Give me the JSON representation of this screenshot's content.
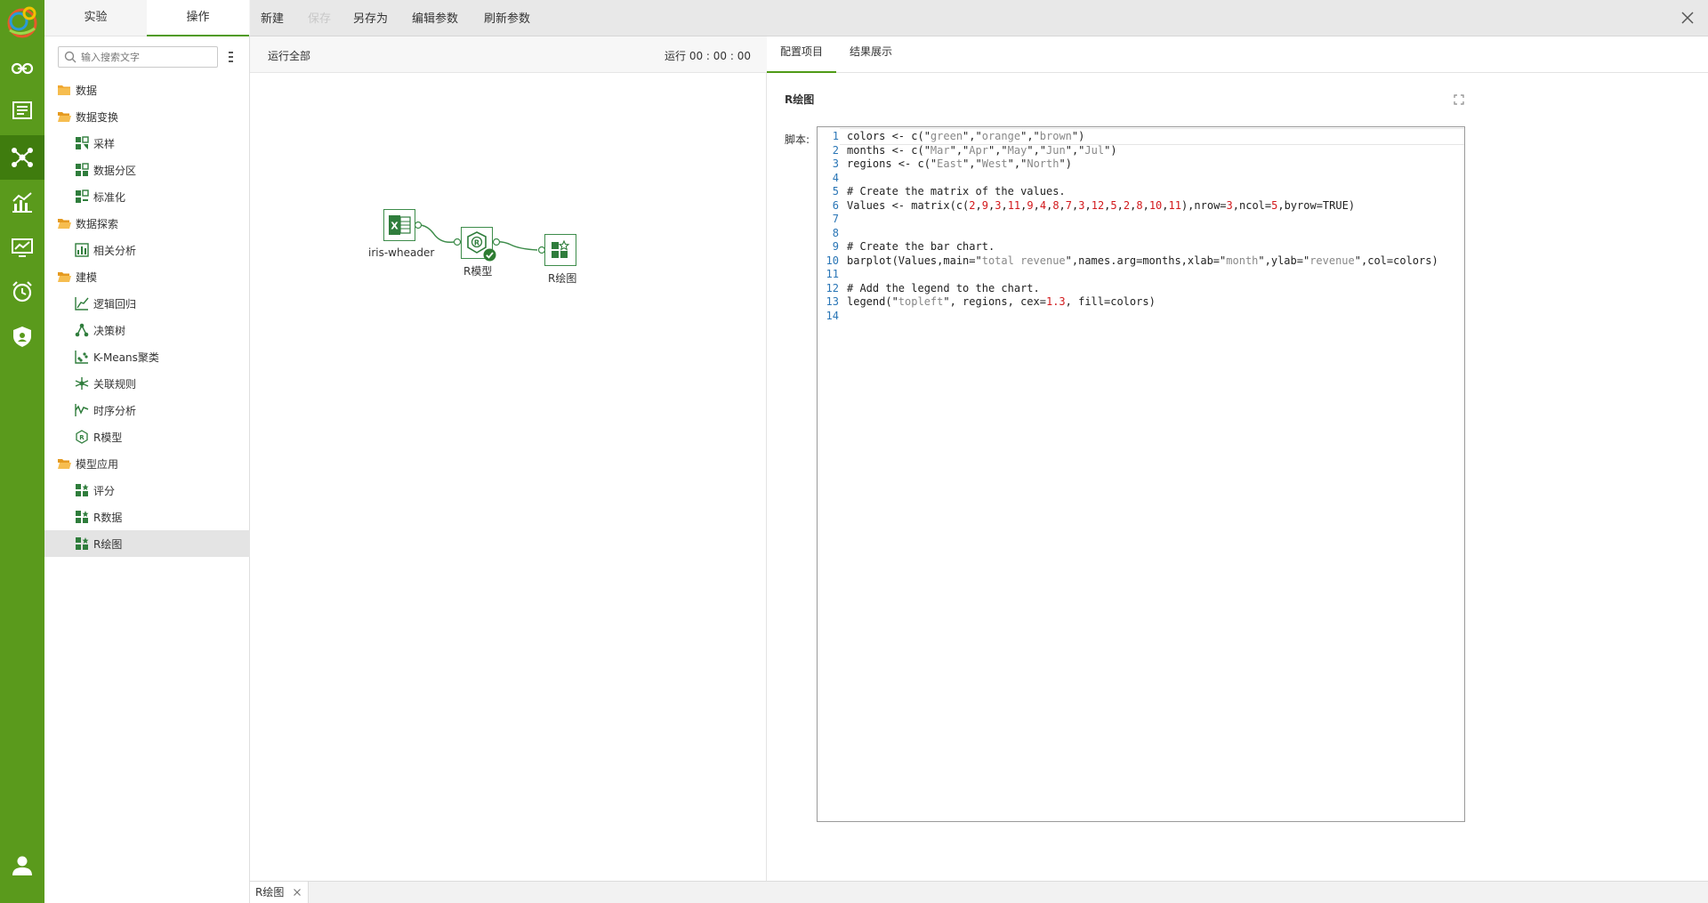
{
  "tree": {
    "tabs": [
      "实验",
      "操作"
    ],
    "search_placeholder": "输入搜索文字",
    "items": [
      {
        "label": "数据",
        "level": 0,
        "icon": "folder-icon"
      },
      {
        "label": "数据变换",
        "level": 0,
        "icon": "folder-open-icon"
      },
      {
        "label": "采样",
        "level": 1,
        "icon": "sampling-icon"
      },
      {
        "label": "数据分区",
        "level": 1,
        "icon": "partition-icon"
      },
      {
        "label": "标准化",
        "level": 1,
        "icon": "normalize-icon"
      },
      {
        "label": "数据探索",
        "level": 0,
        "icon": "folder-open-icon"
      },
      {
        "label": "相关分析",
        "level": 1,
        "icon": "correlation-icon"
      },
      {
        "label": "建模",
        "level": 0,
        "icon": "folder-open-icon"
      },
      {
        "label": "逻辑回归",
        "level": 1,
        "icon": "regression-icon"
      },
      {
        "label": "决策树",
        "level": 1,
        "icon": "tree-icon"
      },
      {
        "label": "K-Means聚类",
        "level": 1,
        "icon": "cluster-icon"
      },
      {
        "label": "关联规则",
        "level": 1,
        "icon": "association-icon"
      },
      {
        "label": "时序分析",
        "level": 1,
        "icon": "timeseries-icon"
      },
      {
        "label": "R模型",
        "level": 1,
        "icon": "r-model-icon"
      },
      {
        "label": "模型应用",
        "level": 0,
        "icon": "folder-open-icon"
      },
      {
        "label": "评分",
        "level": 1,
        "icon": "grid-app-icon"
      },
      {
        "label": "R数据",
        "level": 1,
        "icon": "grid-app-icon"
      },
      {
        "label": "R绘图",
        "level": 1,
        "icon": "grid-app-icon",
        "selected": true
      }
    ]
  },
  "toolbar": {
    "new": "新建",
    "save": "保存",
    "save_as": "另存为",
    "edit_params": "编辑参数",
    "refresh_params": "刷新参数"
  },
  "canvas": {
    "run_all": "运行全部",
    "timer": "运行 00 : 00 : 00",
    "nodes": [
      {
        "label": "iris-wheader",
        "icon": "excel-icon"
      },
      {
        "label": "R模型",
        "icon": "r-model-icon",
        "status": "success"
      },
      {
        "label": "R绘图",
        "icon": "grid-app-icon"
      }
    ]
  },
  "panel": {
    "tabs": [
      "配置项目",
      "结果展示"
    ],
    "title": "R绘图",
    "script_label": "脚本:",
    "code_lines": [
      "colors <- c(\"green\",\"orange\",\"brown\")",
      "months <- c(\"Mar\",\"Apr\",\"May\",\"Jun\",\"Jul\")",
      "regions <- c(\"East\",\"West\",\"North\")",
      "",
      "# Create the matrix of the values.",
      "Values <- matrix(c(2,9,3,11,9,4,8,7,3,12,5,2,8,10,11),nrow=3,ncol=5,byrow=TRUE)",
      "",
      "",
      "# Create the bar chart.",
      "barplot(Values,main=\"total revenue\",names.arg=months,xlab=\"month\",ylab=\"revenue\",col=colors)",
      "",
      "# Add the legend to the chart.",
      "legend(\"topleft\", regions, cex=1.3, fill=colors)",
      ""
    ]
  },
  "bottom_tabs": [
    {
      "label": "R绘图"
    }
  ],
  "colors": {
    "rail": "#5a9a1c",
    "accent": "#4f9b16",
    "node_green": "#2f7d3c"
  }
}
